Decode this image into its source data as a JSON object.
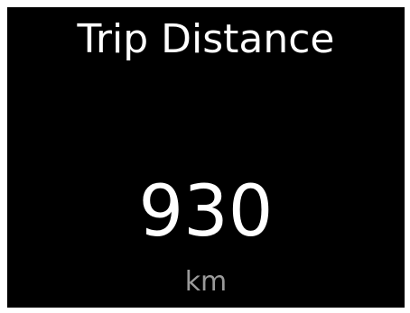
{
  "screen": {
    "title": "Trip Distance",
    "value": "930",
    "unit": "km",
    "background_color": "#000000",
    "text_color": "#ffffff",
    "unit_color": "#9a9a9a"
  }
}
